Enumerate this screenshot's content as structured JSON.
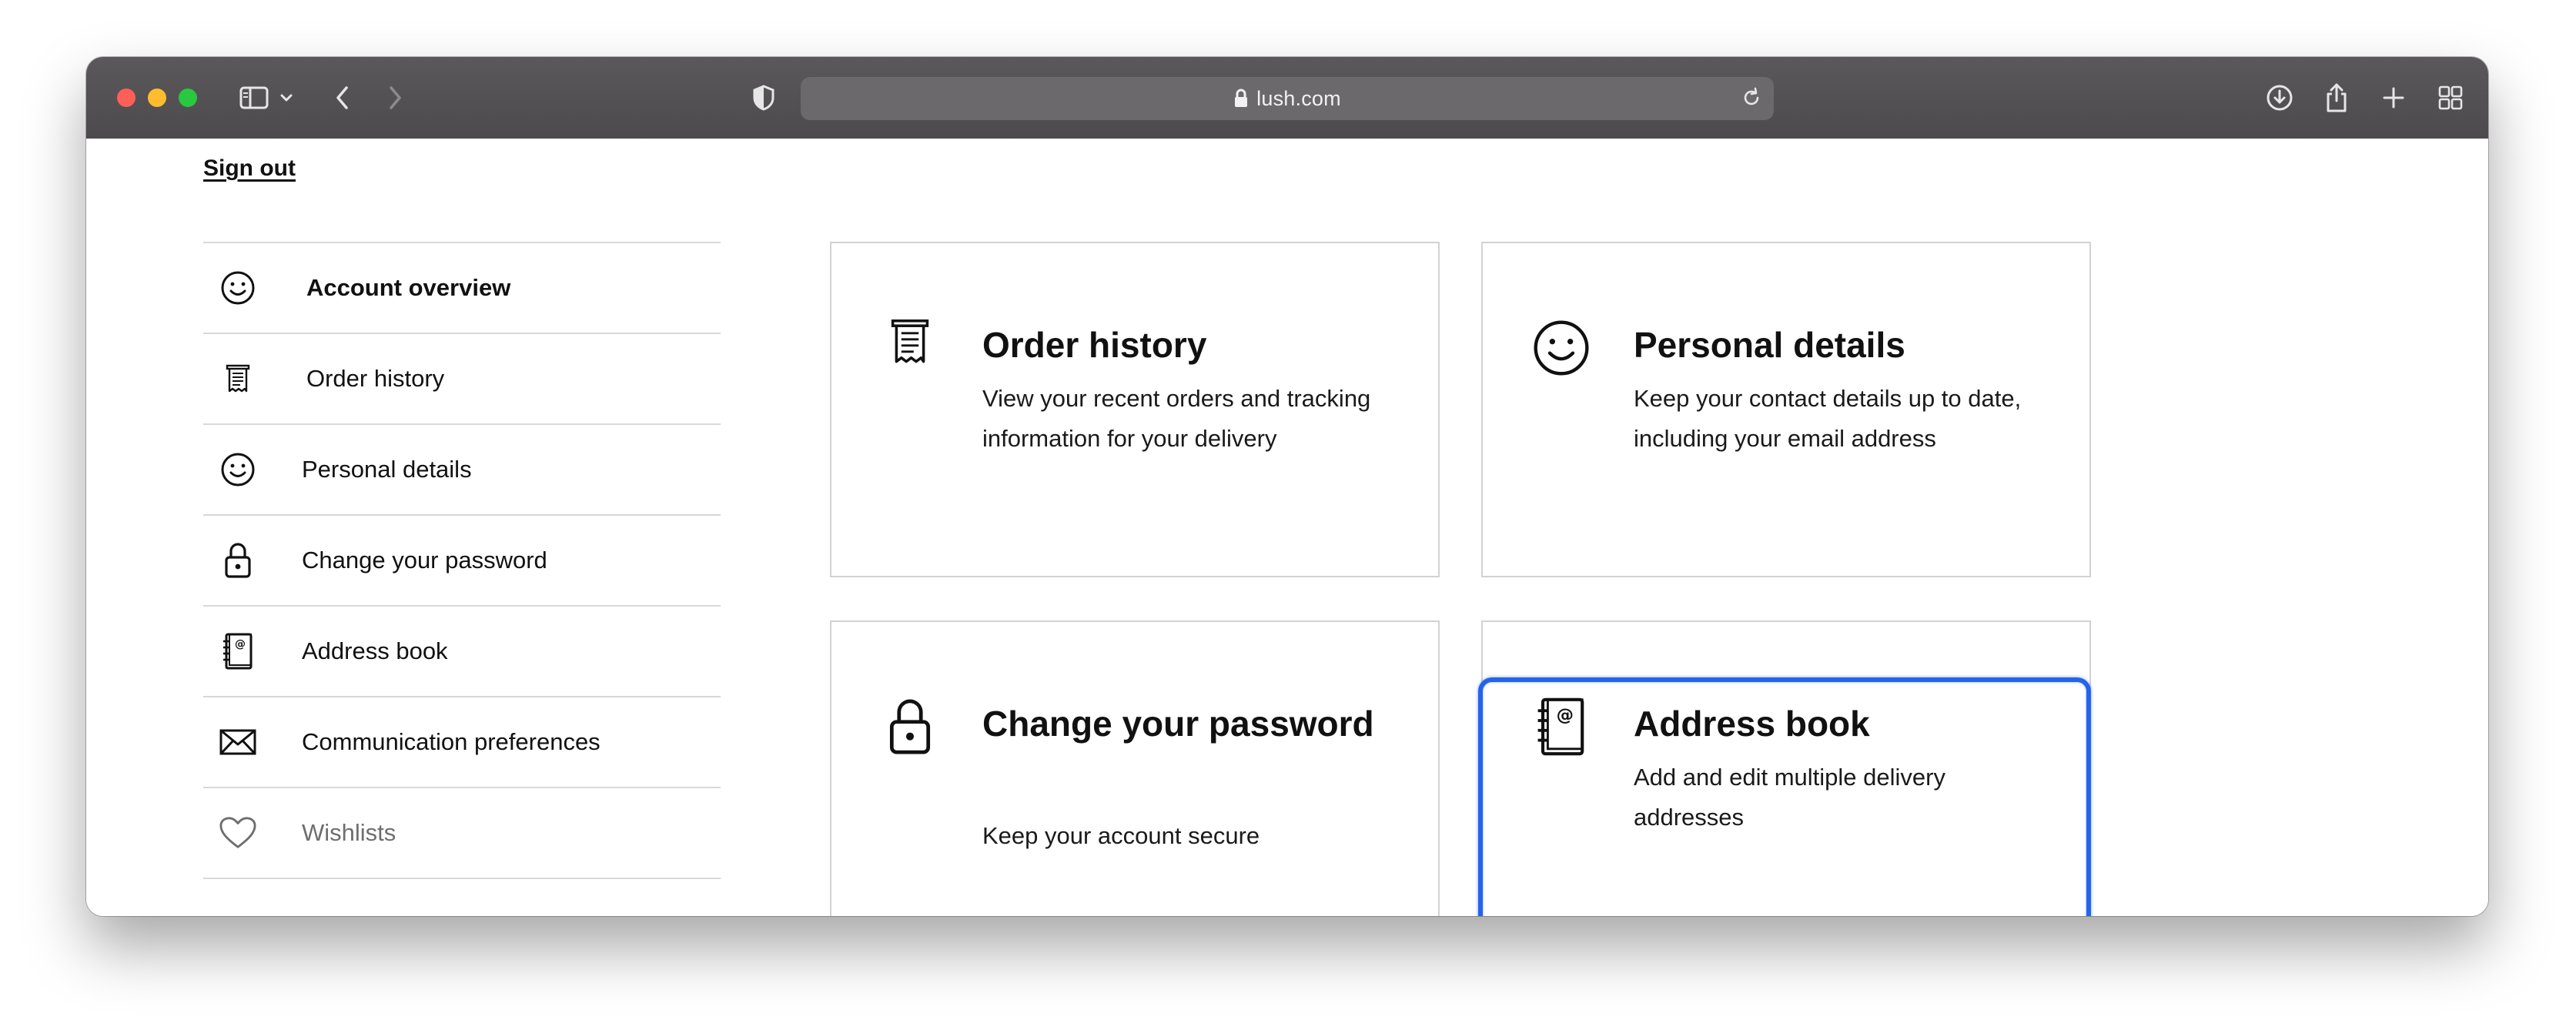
{
  "browser": {
    "url": "lush.com",
    "icons": {
      "sidebar_toggle": "sidebar-icon",
      "back": "chevron-left-icon",
      "forward": "chevron-right-icon",
      "shield": "shield-icon",
      "lock": "lock-icon",
      "reload": "reload-icon",
      "download": "download-icon",
      "share": "share-icon",
      "new_tab": "plus-icon",
      "tab_overview": "tab-grid-icon"
    }
  },
  "page": {
    "sign_out": "Sign out",
    "sidebar": {
      "items": [
        {
          "label": "Account overview",
          "icon": "smiley-icon",
          "active": true
        },
        {
          "label": "Order history",
          "icon": "receipt-icon"
        },
        {
          "label": "Personal details",
          "icon": "smiley-icon"
        },
        {
          "label": "Change your password",
          "icon": "lock-icon"
        },
        {
          "label": "Address book",
          "icon": "address-book-icon"
        },
        {
          "label": "Communication preferences",
          "icon": "envelope-icon"
        },
        {
          "label": "Wishlists",
          "icon": "heart-icon",
          "muted": true
        }
      ]
    },
    "cards": [
      {
        "title": "Order history",
        "description": "View your recent orders and tracking information for your delivery",
        "icon": "receipt-icon"
      },
      {
        "title": "Personal details",
        "description": "Keep your contact details up to date, including your email address",
        "icon": "smiley-icon"
      },
      {
        "title": "Change your password",
        "description": "Keep your account secure",
        "icon": "lock-icon"
      },
      {
        "title": "Address book",
        "description": "Add and edit multiple delivery addresses",
        "icon": "address-book-icon",
        "highlighted": true
      }
    ],
    "highlight_color": "#2563eb"
  }
}
